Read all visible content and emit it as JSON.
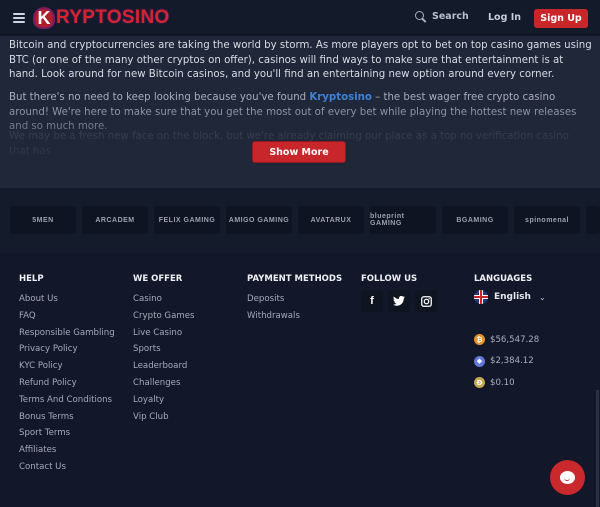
{
  "header": {
    "logo": {
      "mark": "K",
      "text": "RYPTOSINO"
    },
    "search_label": "Search",
    "login_label": "Log In",
    "signup_label": "Sign Up"
  },
  "intro": {
    "paragraph1": "Bitcoin and cryptocurrencies are taking the world by storm. As more players opt to bet on top casino games using BTC (or one of the many other cryptos on offer), casinos will find ways to make sure that entertainment is at hand. Look around for new Bitcoin casinos, and you'll find an entertaining new option around every corner.",
    "paragraph2_before": "But there's no need to keep looking because you've found ",
    "paragraph2_brand": "Kryptosino",
    "paragraph2_after": " – the best wager free crypto casino around! We're here to make sure that you get the most out of every bet while playing the hottest new releases and so much more.",
    "paragraph3": "We may be a fresh new face on the block, but we're already claiming our place as a top no verification casino that has",
    "show_more_label": "Show More"
  },
  "providers": [
    "5MEN",
    "ARCADEM",
    "FELIX GAMING",
    "AMIGO GAMING",
    "AVATARUX",
    "blueprint GAMING",
    "BGAMING",
    "spinomenal"
  ],
  "footer": {
    "help": {
      "title": "HELP",
      "links": [
        "About Us",
        "FAQ",
        "Responsible Gambling",
        "Privacy Policy",
        "KYC Policy",
        "Refund Policy",
        "Terms And Conditions",
        "Bonus Terms",
        "Sport Terms",
        "Affiliates",
        "Contact Us"
      ]
    },
    "offer": {
      "title": "WE OFFER",
      "links": [
        "Casino",
        "Crypto Games",
        "Live Casino",
        "Sports",
        "Leaderboard",
        "Challenges",
        "Loyalty",
        "Vip Club"
      ]
    },
    "payment": {
      "title": "PAYMENT METHODS",
      "links": [
        "Deposits",
        "Withdrawals"
      ]
    },
    "follow": {
      "title": "FOLLOW US",
      "icons": [
        "facebook-icon",
        "twitter-icon",
        "instagram-icon"
      ]
    },
    "languages": {
      "title": "LANGUAGES",
      "selected": "English"
    },
    "prices": [
      {
        "coin": "bitcoin",
        "symbol": "₿",
        "color": "#e8912c",
        "value": "$56,547.28"
      },
      {
        "coin": "ethereum",
        "symbol": "◆",
        "color": "#6177d9",
        "value": "$2,384.12"
      },
      {
        "coin": "dogecoin",
        "symbol": "Ð",
        "color": "#c9a84a",
        "value": "$0.10"
      }
    ]
  },
  "colors": {
    "accent": "#c9262a",
    "link": "#3d83dc",
    "background": "#121829",
    "panel": "#1f2738"
  }
}
